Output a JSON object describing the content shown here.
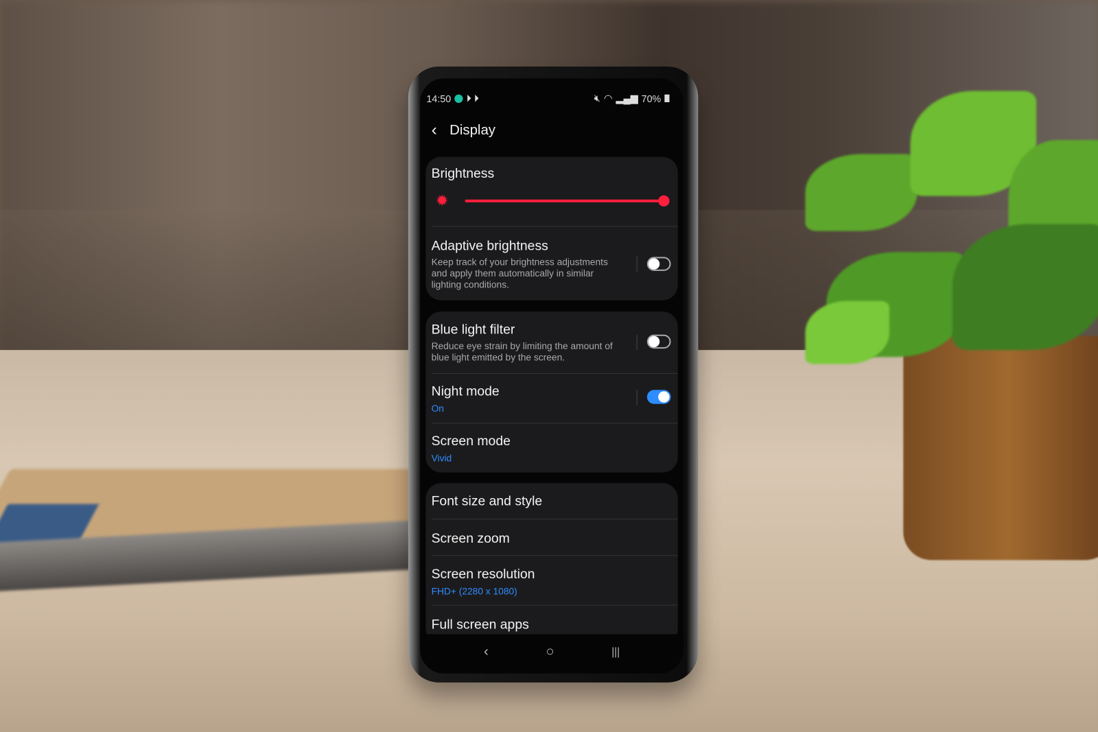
{
  "status_bar": {
    "time": "14:50",
    "battery": "70%",
    "icons": [
      "notification-dot-icon",
      "play-store-icon",
      "play-store-icon",
      "mute-icon",
      "wifi-icon",
      "signal-icon",
      "battery-icon"
    ]
  },
  "header": {
    "title": "Display",
    "back_icon": "chevron-left-icon"
  },
  "brightness": {
    "label": "Brightness",
    "level_percent": 100,
    "accent": "#ff1e3c"
  },
  "settings": [
    {
      "title": "Adaptive brightness",
      "subtitle": "Keep track of your brightness adjustments and apply them automatically in similar lighting conditions.",
      "toggle": false
    },
    {
      "title": "Blue light filter",
      "subtitle": "Reduce eye strain by limiting the amount of blue light emitted by the screen.",
      "toggle": false
    },
    {
      "title": "Night mode",
      "value": "On",
      "toggle": true
    },
    {
      "title": "Screen mode",
      "value": "Vivid"
    },
    {
      "title": "Font size and style"
    },
    {
      "title": "Screen zoom"
    },
    {
      "title": "Screen resolution",
      "value": "FHD+ (2280 x 1080)"
    },
    {
      "title": "Full screen apps"
    }
  ],
  "nav_bar": {
    "back": "‹",
    "home": "○",
    "recents": "|||"
  },
  "colors": {
    "toggle_on": "#2f8cff",
    "value_text": "#2f8cff",
    "background": "#050505",
    "card": "#1b1b1d"
  }
}
